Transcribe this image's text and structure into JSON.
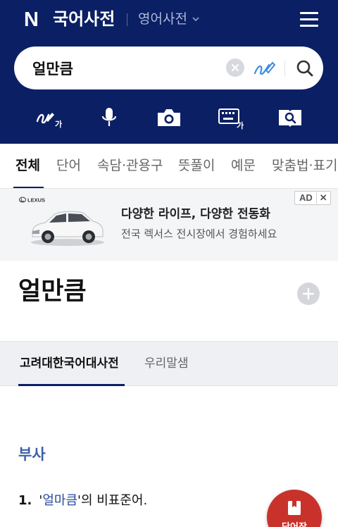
{
  "header": {
    "logo": "N",
    "title": "국어사전",
    "dict_switch": "영어사전"
  },
  "search": {
    "value": "얼만큼"
  },
  "tools": [
    "handwriting-korean-icon",
    "microphone-icon",
    "camera-icon",
    "keyboard-korean-icon",
    "book-search-icon"
  ],
  "tabs": [
    "전체",
    "단어",
    "속담·관용구",
    "뜻풀이",
    "예문",
    "맞춤법·표기"
  ],
  "ad": {
    "brand": "LEXUS",
    "title": "다양한 라이프, 다양한 전동화",
    "desc": "전국 렉서스 전시장에서 경험하세요",
    "badge": "AD",
    "close": "✕"
  },
  "entry": {
    "word": "얼만큼",
    "sources": [
      "고려대한국어대사전",
      "우리말샘"
    ],
    "pos": "부사",
    "sense_num": "1.",
    "sense_quote_open": "'",
    "sense_link": "얼마큼",
    "sense_rest": "'의 비표준어."
  },
  "fab": {
    "label": "단어장"
  },
  "colors": {
    "header_bg": "#0b1f64",
    "fab_bg": "#c9322b",
    "link": "#2b4a9a"
  }
}
